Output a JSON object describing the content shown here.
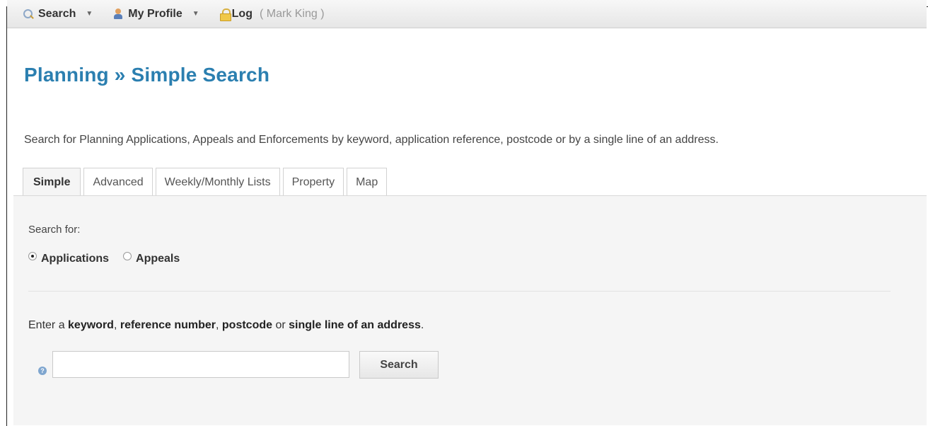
{
  "topbar": {
    "search_label": "Search",
    "profile_label": "My Profile",
    "logout_label": "Log",
    "user_text": "( Mark King )"
  },
  "page": {
    "title": "Planning » Simple Search",
    "intro": "Search for Planning Applications, Appeals and Enforcements by keyword, application reference, postcode or by a single line of an address."
  },
  "tabs": [
    {
      "label": "Simple",
      "active": true
    },
    {
      "label": "Advanced"
    },
    {
      "label": "Weekly/Monthly Lists"
    },
    {
      "label": "Property"
    },
    {
      "label": "Map"
    }
  ],
  "form": {
    "search_for_label": "Search for:",
    "radio_options": [
      {
        "label": "Applications",
        "checked": true
      },
      {
        "label": "Appeals",
        "checked": false
      }
    ],
    "instruction": {
      "prefix": "Enter a ",
      "keyword": "keyword",
      "sep1": ", ",
      "reference": "reference number",
      "sep2": ", ",
      "postcode": "postcode",
      "or": " or ",
      "address": "single line of an address",
      "suffix": "."
    },
    "search_value": "",
    "help_glyph": "?",
    "search_button": "Search"
  },
  "icons": {
    "search": "search-icon",
    "profile": "person-icon",
    "logout": "lock-icon",
    "help": "help-icon"
  },
  "colors": {
    "title": "#2b7fb0",
    "panel_bg": "#f5f5f5",
    "topbar_bg": "#e6e6e6"
  }
}
